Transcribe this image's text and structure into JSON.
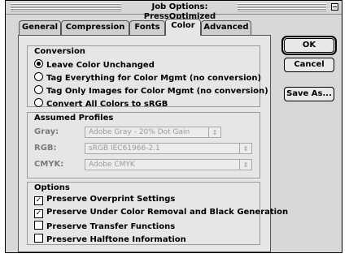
{
  "window": {
    "title": "Job Options: PressOptimized"
  },
  "tabs": [
    "General",
    "Compression",
    "Fonts",
    "Color",
    "Advanced"
  ],
  "active_tab": "Color",
  "conversion": {
    "title": "Conversion",
    "options": [
      "Leave Color Unchanged",
      "Tag Everything for Color Mgmt (no conversion)",
      "Tag Only Images for Color Mgmt (no conversion)",
      "Convert All Colors to sRGB"
    ],
    "selected_index": 0
  },
  "profiles": {
    "title": "Assumed Profiles",
    "gray_label": "Gray:",
    "gray_value": "Adobe Gray - 20% Dot Gain",
    "rgb_label": "RGB:",
    "rgb_value": "sRGB IEC61966-2.1",
    "cmyk_label": "CMYK:",
    "cmyk_value": "Adobe CMYK"
  },
  "options": {
    "title": "Options",
    "items": [
      {
        "label": "Preserve Overprint Settings",
        "checked": true
      },
      {
        "label": "Preserve Under Color Removal and Black Generation",
        "checked": true
      },
      {
        "label": "Preserve Transfer Functions",
        "checked": false
      },
      {
        "label": "Preserve Halftone Information",
        "checked": false
      }
    ]
  },
  "buttons": {
    "ok": "OK",
    "cancel": "Cancel",
    "save_as": "Save As..."
  }
}
